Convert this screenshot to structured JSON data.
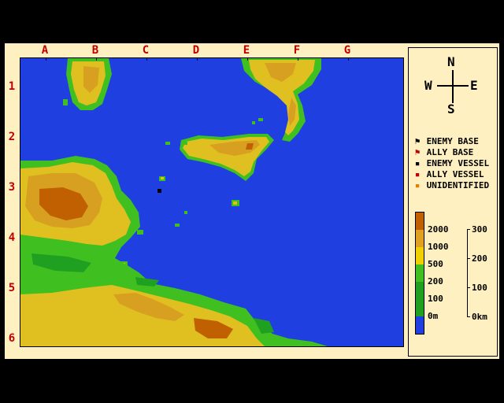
{
  "grid": {
    "columns": [
      "A",
      "B",
      "C",
      "D",
      "E",
      "F",
      "G"
    ],
    "rows": [
      "1",
      "2",
      "3",
      "4",
      "5",
      "6"
    ]
  },
  "compass": {
    "north": "N",
    "south": "S",
    "east": "E",
    "west": "W"
  },
  "legend": [
    {
      "label": "ENEMY BASE",
      "symbol": "flag",
      "color": "#000000"
    },
    {
      "label": "ALLY BASE",
      "symbol": "flag",
      "color": "#c00000"
    },
    {
      "label": "ENEMY VESSEL",
      "symbol": "dot",
      "color": "#000000"
    },
    {
      "label": "ALLY VESSEL",
      "symbol": "dot",
      "color": "#c00000"
    },
    {
      "label": "UNIDENTIFIED",
      "symbol": "dot",
      "color": "#e08000"
    }
  ],
  "elevation_scale": {
    "labels": [
      "2000",
      "1000",
      "500",
      "200",
      "100",
      "0m"
    ],
    "colors": [
      "#c06000",
      "#e0a020",
      "#f0d000",
      "#40c020",
      "#20a020",
      "#1f3fe0"
    ]
  },
  "distance_scale": {
    "labels": [
      "300",
      "200",
      "100",
      "0km"
    ]
  },
  "colors": {
    "sea": "#1f3fe0",
    "lowland": "#40c020",
    "plain": "#e0c020",
    "hills": "#d8a020",
    "mountain": "#c06000",
    "label_red": "#c00000",
    "panel": "#fef0c0"
  }
}
